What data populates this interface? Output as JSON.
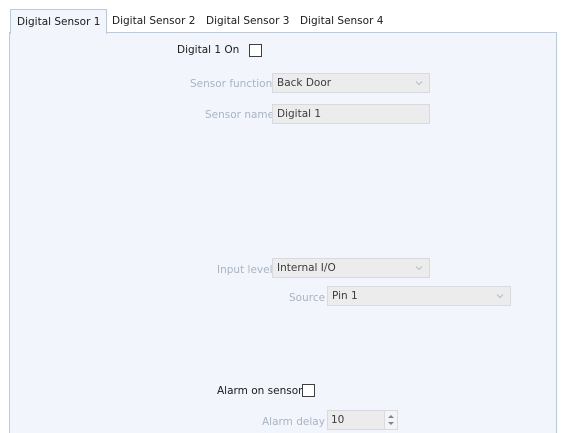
{
  "tabs": [
    {
      "label": "Digital Sensor 1",
      "active": true
    },
    {
      "label": "Digital Sensor 2",
      "active": false
    },
    {
      "label": "Digital Sensor 3",
      "active": false
    },
    {
      "label": "Digital Sensor 4",
      "active": false
    }
  ],
  "sensor": {
    "on_label": "Digital 1 On",
    "on_checked": false,
    "function_label": "Sensor function",
    "function_value": "Back Door",
    "name_label": "Sensor name",
    "name_value": "Digital 1",
    "input_level_label": "Input level",
    "input_level_value": "Internal I/O",
    "source_label": "Source",
    "source_value": "Pin 1"
  },
  "alarm": {
    "on_label": "Alarm on sensor",
    "on_checked": false,
    "delay_label": "Alarm delay",
    "delay_value": "10"
  },
  "colors": {
    "panel_bg": "#f2f6fc",
    "tab_border": "#b8cbe3",
    "disabled_text": "#a8b4c3",
    "disabled_field_bg": "#ececec"
  },
  "icons": {
    "combo_arrow": "chevron-down-icon",
    "spin_up": "spin-up-icon",
    "spin_down": "spin-down-icon"
  }
}
